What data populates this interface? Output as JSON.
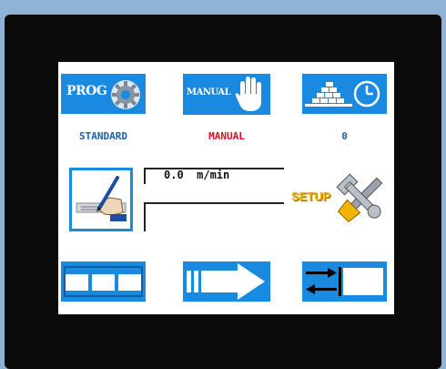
{
  "top_buttons": {
    "prog_label": "PROG",
    "manual_label": "MANUAL"
  },
  "status": {
    "program": "STANDARD",
    "mode": "MANUAL",
    "count": "0"
  },
  "speed": {
    "value_text": "0.0  m/min"
  },
  "setup": {
    "label": "SETUP"
  },
  "colors": {
    "button_blue": "#1a8ae0",
    "program_text": "#1b5fa6",
    "mode_text": "#d8141e",
    "setup_text": "#f2b400"
  },
  "icons": {
    "prog": "gear-icon",
    "manual": "hand-icon",
    "counter": "stack-clock-icon",
    "edit": "pen-writing-icon",
    "setup": "wrench-screwdriver-icon",
    "steps": "steps-icon",
    "forward": "forward-arrow-icon",
    "reverse": "reverse-arrows-icon"
  }
}
